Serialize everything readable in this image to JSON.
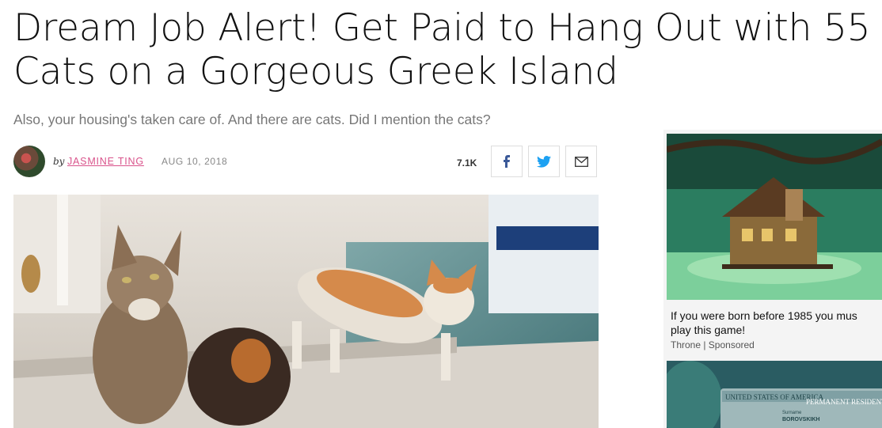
{
  "article": {
    "headline_line1": "Dream Job Alert! Get Paid to Hang Out with 55",
    "headline_line2": "Cats on a Gorgeous Greek Island",
    "dek": "Also, your housing's taken care of. And there are cats. Did I mention the cats?",
    "byline_prefix": "by",
    "author": "JASMINE TING",
    "date": "AUG 10, 2018",
    "share_count": "7.1K",
    "hero_alt": "cats on a dock"
  },
  "share": {
    "facebook_icon": "facebook-icon",
    "twitter_icon": "twitter-icon",
    "email_icon": "email-icon"
  },
  "sidebar_ad": {
    "title_line1": "If you were born before 1985 you mus",
    "title_line2": "play this game!",
    "sponsor": "Throne | Sponsored",
    "card2_text1": "UNITED STATES OF AMERICA",
    "card2_text2": "PERMANENT RESIDENT",
    "card2_surname": "Surname",
    "card2_name": "BOROVSKIKH"
  },
  "colors": {
    "author": "#d9538b",
    "facebook": "#3b5998",
    "twitter": "#1da1f2"
  }
}
